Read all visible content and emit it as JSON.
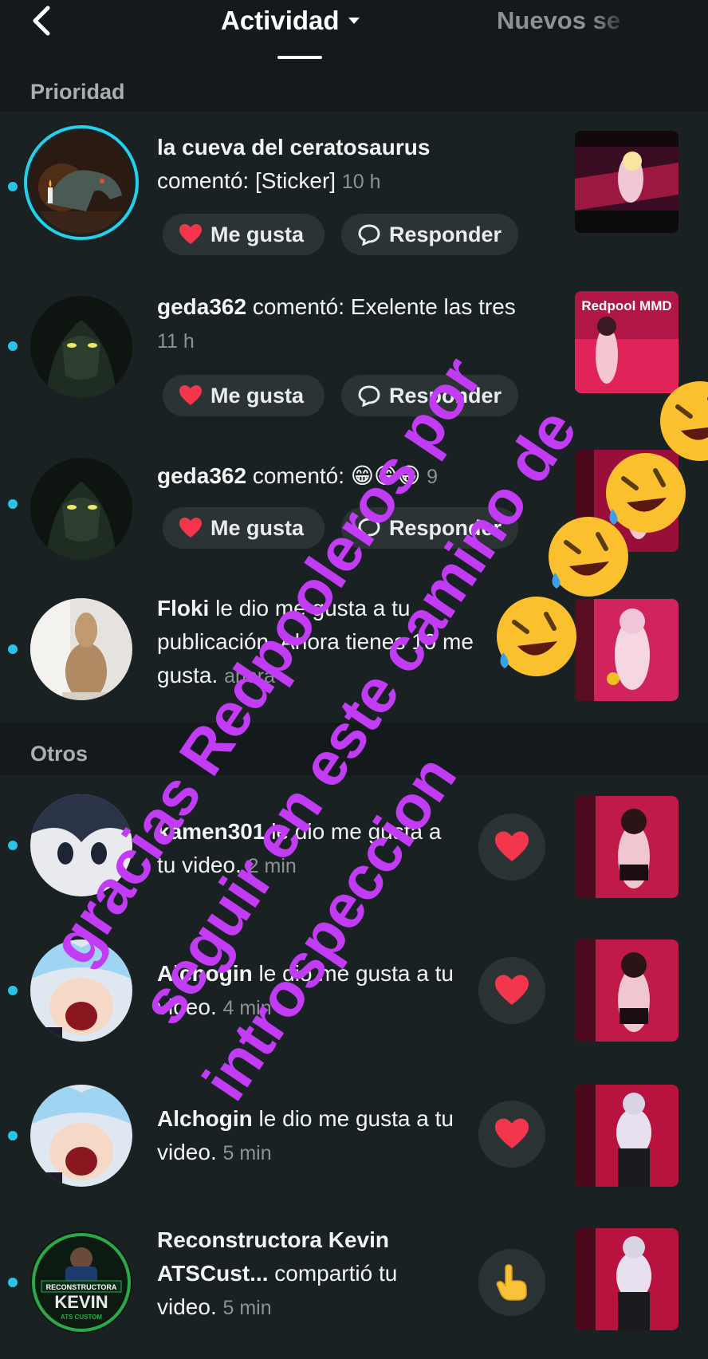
{
  "header": {
    "title": "Actividad",
    "second_tab": "Nuevos se"
  },
  "sections": {
    "priority": "Prioridad",
    "others": "Otros"
  },
  "priority_items": [
    {
      "user": "la cueva del ceratosaurus",
      "action": "comentó: [Sticker]",
      "time": "10 h",
      "like_label": "Me gusta",
      "reply_label": "Responder"
    },
    {
      "user": "geda362",
      "action": "comentó: Exelente las tres",
      "time": "11 h",
      "like_label": "Me gusta",
      "reply_label": "Responder"
    },
    {
      "user": "geda362",
      "action": "comentó: 😁😁😁",
      "time": "9",
      "like_label": "Me gusta",
      "reply_label": "Responder"
    },
    {
      "user": "Floki",
      "action": "le dio me gusta a tu publicación. Ahora tienes 10 me gusta.",
      "time": "ahora"
    }
  ],
  "other_items": [
    {
      "user": "kamen301",
      "action": "le dio me gusta a tu video.",
      "time": "2 min",
      "icon": "heart-icon"
    },
    {
      "user": "Alchogin",
      "action": "le dio me gusta a tu video.",
      "time": "4 min",
      "icon": "heart-icon"
    },
    {
      "user": "Alchogin",
      "action": "le dio me gusta a tu video.",
      "time": "5 min",
      "icon": "heart-icon"
    },
    {
      "user": "Reconstructora Kevin ATSCust...",
      "action": "compartió tu video.",
      "time": "5 min",
      "icon": "pointing-hand-icon"
    }
  ],
  "thumbnail_text": "Redpool MMD",
  "avatar_text": {
    "reconstructora_1": "RECONSTRUCTORA",
    "reconstructora_2": "KEVIN",
    "reconstructora_3": "ATS CUSTOM"
  },
  "overlay": {
    "line1": "gracias Redpooleros por",
    "line2": "seguir en este camino de",
    "line3": "introspeccion"
  },
  "colors": {
    "background": "#1a2123",
    "header_bg": "#141a1b",
    "accent_dot": "#28c3e6",
    "heart": "#f4364c",
    "overlay_text": "#c13cf4"
  }
}
